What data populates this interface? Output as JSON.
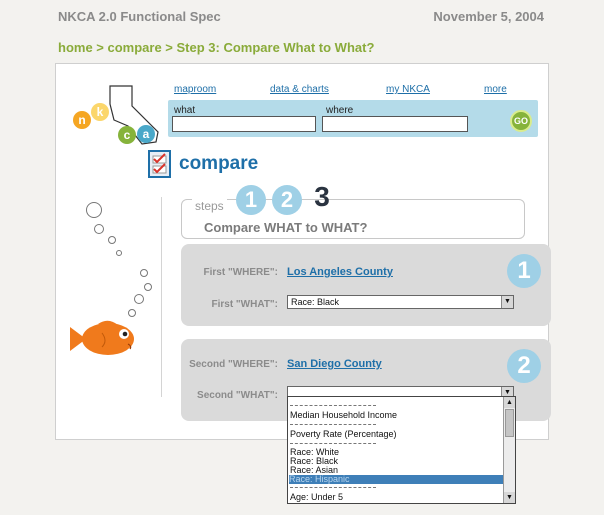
{
  "doc": {
    "spec_title": "NKCA 2.0 Functional Spec",
    "date": "November 5, 2004",
    "breadcrumb": "home > compare > Step 3: Compare What to What?"
  },
  "logo": {
    "letters": [
      "n",
      "k",
      "c",
      "a"
    ]
  },
  "nav": {
    "items": [
      "maproom",
      "data & charts",
      "my NKCA",
      "more"
    ]
  },
  "search": {
    "what_label": "what",
    "where_label": "where",
    "what_value": "",
    "where_value": "",
    "go_label": "GO"
  },
  "compare": {
    "title": "compare"
  },
  "steps": {
    "word": "steps",
    "numbers": [
      "1",
      "2",
      "3"
    ],
    "active": "3",
    "subtitle": "Compare WHAT to WHAT?"
  },
  "first": {
    "number": "1",
    "where_label": "First \"WHERE\":",
    "where_value": "Los Angeles County",
    "what_label": "First \"WHAT\":",
    "what_value": "Race: Black"
  },
  "second": {
    "number": "2",
    "where_label": "Second \"WHERE\":",
    "where_value": "San Diego County",
    "what_label": "Second \"WHAT\":",
    "what_value": ""
  },
  "dropdown": {
    "options": [
      "Median Household Income",
      "Poverty Rate (Percentage)",
      "Race: White",
      "Race: Black",
      "Race: Asian",
      "Race: Hispanic",
      "Age: Under 5"
    ],
    "highlighted": "Race: Hispanic"
  },
  "colors": {
    "accent_blue": "#1e6fa8",
    "light_blue": "#9fd0e6",
    "green": "#86b33b",
    "fish_orange": "#f07a1c"
  }
}
